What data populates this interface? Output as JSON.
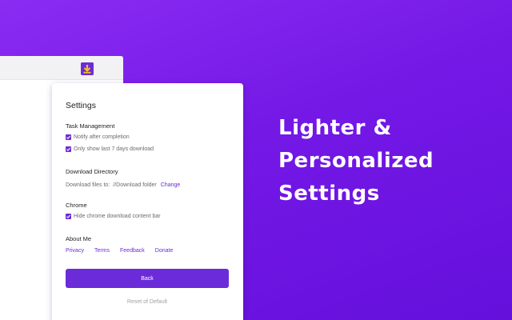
{
  "headline": {
    "line1": "Lighter &",
    "line2": "Personalized",
    "line3": "Settings"
  },
  "settings": {
    "title": "Settings",
    "task_management": {
      "title": "Task Management",
      "notify": {
        "label": "Notify after completion",
        "checked": true
      },
      "last7": {
        "label": "Only show last 7 days download",
        "checked": true
      }
    },
    "download_directory": {
      "title": "Download Directory",
      "label": "Download files to:",
      "path": "//Download folder",
      "change_label": "Change"
    },
    "chrome": {
      "title": "Chrome",
      "hide_bar": {
        "label": "Hide chrome download content bar",
        "checked": true
      }
    },
    "about": {
      "title": "About Me",
      "links": [
        "Privacy",
        "Terms",
        "Feedback",
        "Donate"
      ]
    },
    "back_label": "Back",
    "reset_label": "Reset of Default"
  },
  "colors": {
    "accent": "#6c2bd9",
    "background_start": "#8a2cf2",
    "background_end": "#6510dc"
  },
  "icons": {
    "extension": "download-arrow-icon",
    "checkbox": "check-icon"
  }
}
